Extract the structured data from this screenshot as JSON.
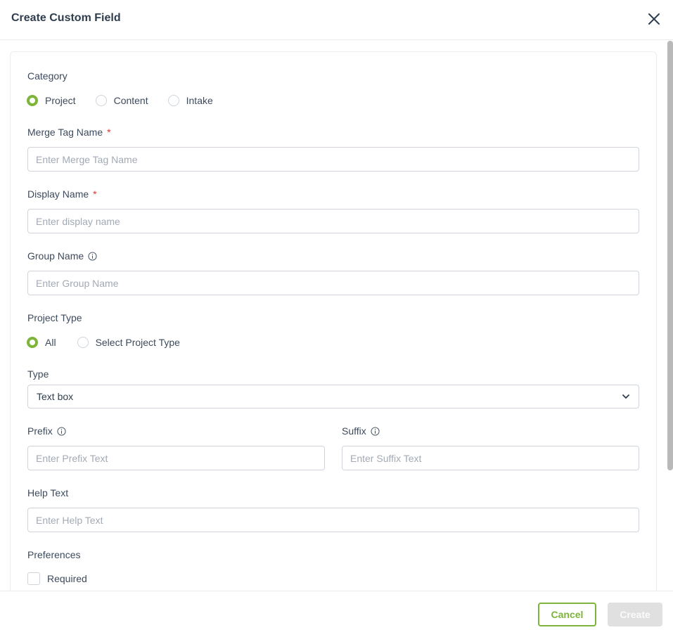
{
  "dialog": {
    "title": "Create Custom Field",
    "close_icon": "close-icon"
  },
  "form": {
    "category": {
      "label": "Category",
      "options": [
        {
          "label": "Project",
          "selected": true
        },
        {
          "label": "Content",
          "selected": false
        },
        {
          "label": "Intake",
          "selected": false
        }
      ]
    },
    "merge_tag_name": {
      "label": "Merge Tag Name",
      "required_mark": "*",
      "value": "",
      "placeholder": "Enter Merge Tag Name"
    },
    "display_name": {
      "label": "Display Name",
      "required_mark": "*",
      "value": "",
      "placeholder": "Enter display name"
    },
    "group_name": {
      "label": "Group Name",
      "icon": "info-icon",
      "value": "",
      "placeholder": "Enter Group Name"
    },
    "project_type": {
      "label": "Project Type",
      "options": [
        {
          "label": "All",
          "selected": true
        },
        {
          "label": "Select Project Type",
          "selected": false
        }
      ]
    },
    "type": {
      "label": "Type",
      "selected": "Text box",
      "icon": "chevron-down-icon"
    },
    "prefix": {
      "label": "Prefix",
      "icon": "info-icon",
      "value": "",
      "placeholder": "Enter Prefix Text"
    },
    "suffix": {
      "label": "Suffix",
      "icon": "info-icon",
      "value": "",
      "placeholder": "Enter Suffix Text"
    },
    "help_text": {
      "label": "Help Text",
      "value": "",
      "placeholder": "Enter Help Text"
    },
    "preferences": {
      "label": "Preferences",
      "required": {
        "label": "Required",
        "checked": false
      }
    }
  },
  "footer": {
    "cancel_label": "Cancel",
    "create_label": "Create",
    "create_disabled": true
  },
  "colors": {
    "accent": "#7cb53a",
    "required": "#e5322d",
    "disabled_button": "#e0e0e0"
  }
}
